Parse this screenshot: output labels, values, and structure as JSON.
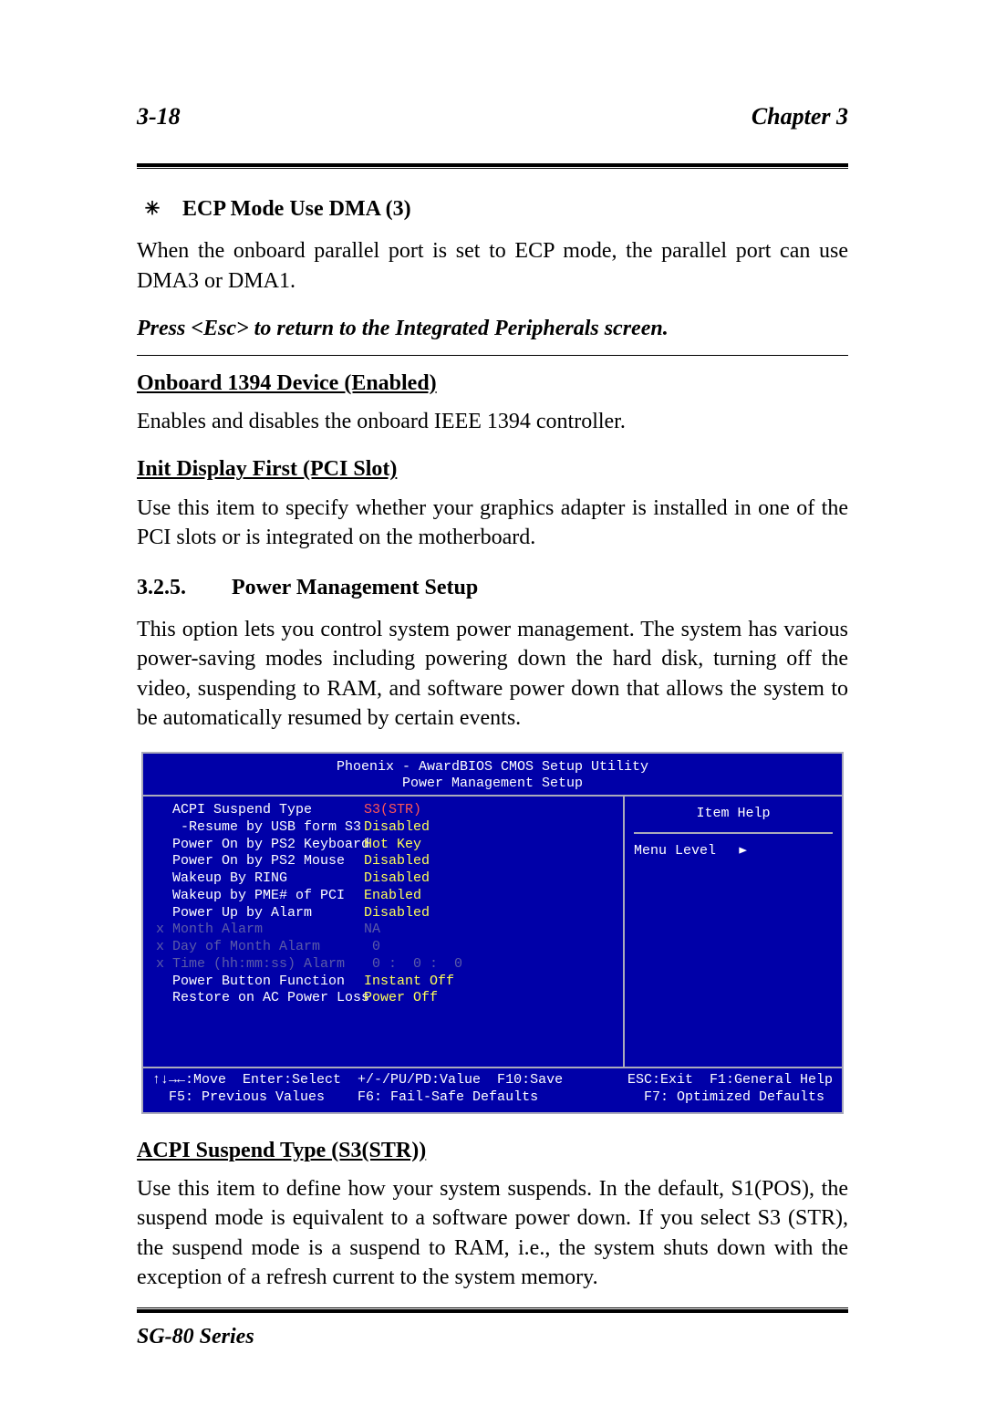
{
  "header": {
    "page_num": "3-18",
    "chapter": "Chapter 3"
  },
  "s1": {
    "heading": "ECP Mode Use DMA (3)",
    "para": "When the onboard parallel port is set to ECP mode, the parallel port can use DMA3 or DMA1.",
    "instr": "Press <Esc> to return to the Integrated Peripherals screen."
  },
  "s2": {
    "heading": "Onboard 1394 Device (Enabled)",
    "para": "Enables and disables the onboard IEEE 1394 controller."
  },
  "s3": {
    "heading": "Init Display First (PCI Slot)",
    "para": "Use this item to specify whether your graphics adapter is installed in one of the PCI slots or is integrated on the motherboard."
  },
  "s4": {
    "num": "3.2.5.",
    "title": "Power Management Setup",
    "para": "This option lets you control system power management. The system has various power-saving modes including powering down the hard disk, turning off the video, suspending to RAM, and software power down that allows the system to be automatically resumed by certain events."
  },
  "bios": {
    "title_line1": "Phoenix - AwardBIOS CMOS Setup Utility",
    "title_line2": "Power Management Setup",
    "right": {
      "item_help": "Item Help",
      "menu_level": "Menu Level",
      "arrow": "►"
    },
    "rows": [
      {
        "label": "  ACPI Suspend Type",
        "value": "S3(STR)",
        "dim": false,
        "sel": true
      },
      {
        "label": "   -Resume by USB form S3",
        "value": "Disabled",
        "dim": false,
        "sel": false
      },
      {
        "label": "  Power On by PS2 Keyboard",
        "value": "Hot Key",
        "dim": false,
        "sel": false
      },
      {
        "label": "  Power On by PS2 Mouse",
        "value": "Disabled",
        "dim": false,
        "sel": false
      },
      {
        "label": "  Wakeup By RING",
        "value": "Disabled",
        "dim": false,
        "sel": false
      },
      {
        "label": "  Wakeup by PME# of PCI",
        "value": "Enabled",
        "dim": false,
        "sel": false
      },
      {
        "label": "  Power Up by Alarm",
        "value": "Disabled",
        "dim": false,
        "sel": false
      },
      {
        "label": "x Month Alarm",
        "value": "NA",
        "dim": true,
        "sel": false
      },
      {
        "label": "x Day of Month Alarm",
        "value": " 0",
        "dim": true,
        "sel": false
      },
      {
        "label": "x Time (hh:mm:ss) Alarm",
        "value": " 0 :  0 :  0",
        "dim": true,
        "sel": false
      },
      {
        "label": "  Power Button Function",
        "value": "Instant Off",
        "dim": false,
        "sel": false
      },
      {
        "label": "  Restore on AC Power Loss",
        "value": "Power Off",
        "dim": false,
        "sel": false
      }
    ],
    "footer": {
      "l1_left": "↑↓→←:Move  Enter:Select  +/-/PU/PD:Value  F10:Save",
      "l1_right": "ESC:Exit  F1:General Help",
      "l2_left": "  F5: Previous Values    F6: Fail-Safe Defaults",
      "l2_right": "F7: Optimized Defaults "
    }
  },
  "s5": {
    "heading": "ACPI Suspend Type (S3(STR))",
    "para": "Use this item to define how your system suspends. In the default, S1(POS), the suspend mode is equivalent to a software power down. If you select S3 (STR), the suspend mode is a suspend to RAM, i.e., the system shuts down with the exception of a refresh current to the system memory."
  },
  "footer": {
    "series": "SG-80 Series"
  }
}
